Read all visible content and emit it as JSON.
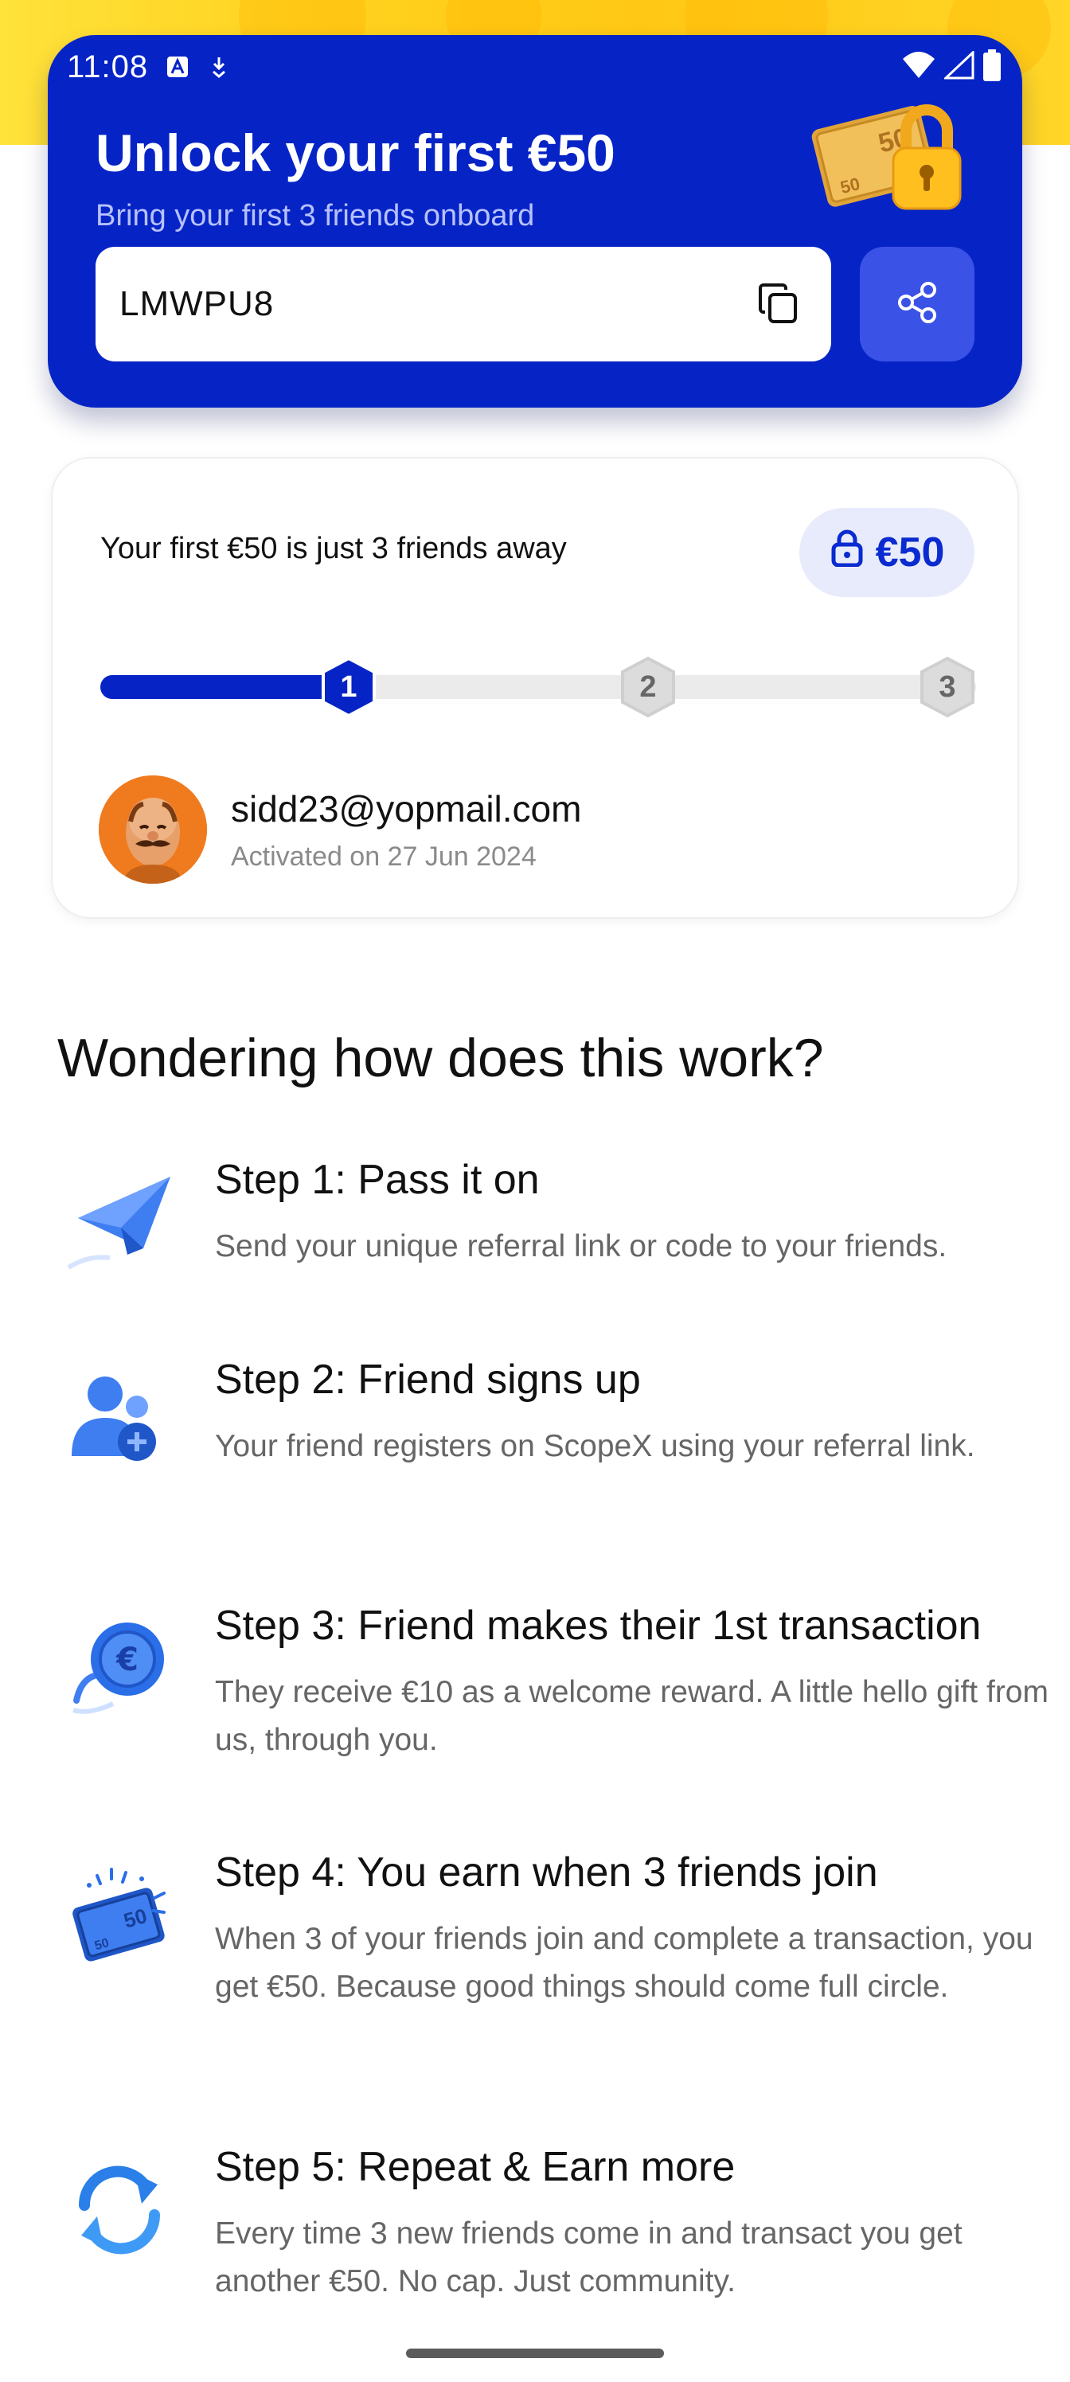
{
  "status_bar": {
    "time": "11:08"
  },
  "hero": {
    "title": "Unlock your first €50",
    "subtitle": "Bring your first 3 friends onboard",
    "referral_code": "LMWPU8",
    "colors": {
      "background": "#0624c6",
      "share_button": "#3a52e6",
      "top_decoration": "#ffd21f"
    }
  },
  "progress": {
    "text": "Your first €50 is just 3 friends away",
    "badge_amount": "€50",
    "completed": 1,
    "total": 3,
    "steps": [
      "1",
      "2",
      "3"
    ],
    "friend": {
      "email": "sidd23@yopmail.com",
      "activated": "Activated on 27 Jun 2024"
    }
  },
  "how_it_works": {
    "title": "Wondering how does this work?",
    "steps": [
      {
        "title": "Step 1: Pass it on",
        "description": "Send your unique referral link or code to your friends.",
        "icon": "paper-plane-icon"
      },
      {
        "title": "Step 2: Friend signs up",
        "description": "Your friend registers on ScopeX using your referral link.",
        "icon": "add-user-icon"
      },
      {
        "title": "Step 3: Friend makes their 1st transaction",
        "description": "They receive €10 as a welcome reward. A little hello gift from us, through you.",
        "icon": "euro-coin-icon"
      },
      {
        "title": "Step 4: You earn when 3 friends join",
        "description": "When 3 of your friends join and complete a transaction, you get €50. Because good things should come full circle.",
        "icon": "money-bundle-icon"
      },
      {
        "title": "Step 5: Repeat & Earn more",
        "description": "Every time 3 new friends come in and transact you get another €50. No cap. Just community.",
        "icon": "repeat-icon"
      }
    ]
  }
}
